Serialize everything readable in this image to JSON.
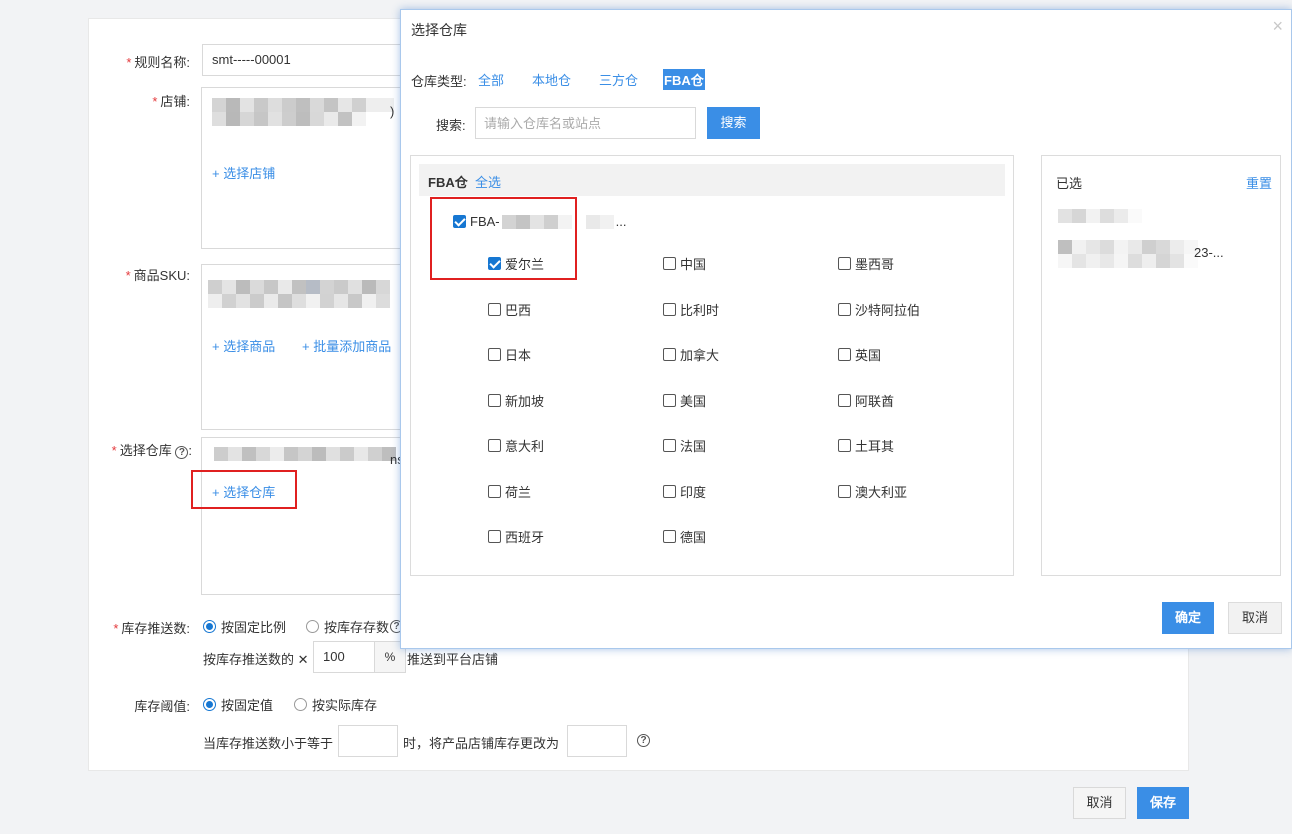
{
  "form": {
    "rule_name_label": "规则名称:",
    "rule_name_value": "smt-----00001",
    "shop_label": "店铺:",
    "shop_text_tail": ")",
    "select_shop": "+ 选择店铺",
    "sku_label": "商品SKU:",
    "select_product": "+ 选择商品",
    "batch_add_product": "+ 批量添加商品",
    "warehouse_label": "选择仓库",
    "warehouse_text_tail": "ns",
    "select_warehouse": "+ 选择仓库",
    "push_label": "库存推送数:",
    "push_option_ratio": "按固定比例",
    "push_option_stock": "按库存存数",
    "push_text_prefix": "按库存推送数的 ✕",
    "push_percent_value": "100",
    "push_percent_unit": "%",
    "push_text_suffix": "推送到平台店铺",
    "threshold_label": "库存阈值:",
    "threshold_option_fixed": "按固定值",
    "threshold_option_actual": "按实际库存",
    "threshold_text_prefix": "当库存推送数小于等于",
    "threshold_text_middle": "时，将产品店铺库存更改为",
    "threshold_min_value": "",
    "threshold_set_value": "",
    "cancel": "取消",
    "save": "保存"
  },
  "modal": {
    "title": "选择仓库",
    "close_glyph": "×",
    "type_label": "仓库类型:",
    "types": [
      {
        "label": "全部",
        "active": false
      },
      {
        "label": "本地仓",
        "active": false
      },
      {
        "label": "三方仓",
        "active": false
      },
      {
        "label": "FBA仓",
        "active": true
      }
    ],
    "search_label": "搜索:",
    "search_placeholder": "请输入仓库名或站点",
    "search_button": "搜索",
    "group_title": "FBA仓",
    "select_all": "全选",
    "parent_item": {
      "label_prefix": "FBA-",
      "label_suffix": "...",
      "checked": true
    },
    "countries": [
      {
        "label": "爱尔兰",
        "checked": true
      },
      {
        "label": "中国",
        "checked": false
      },
      {
        "label": "墨西哥",
        "checked": false
      },
      {
        "label": "巴西",
        "checked": false
      },
      {
        "label": "比利时",
        "checked": false
      },
      {
        "label": "沙特阿拉伯",
        "checked": false
      },
      {
        "label": "日本",
        "checked": false
      },
      {
        "label": "加拿大",
        "checked": false
      },
      {
        "label": "英国",
        "checked": false
      },
      {
        "label": "新加坡",
        "checked": false
      },
      {
        "label": "美国",
        "checked": false
      },
      {
        "label": "阿联酋",
        "checked": false
      },
      {
        "label": "意大利",
        "checked": false
      },
      {
        "label": "法国",
        "checked": false
      },
      {
        "label": "土耳其",
        "checked": false
      },
      {
        "label": "荷兰",
        "checked": false
      },
      {
        "label": "印度",
        "checked": false
      },
      {
        "label": "澳大利亚",
        "checked": false
      },
      {
        "label": "西班牙",
        "checked": false
      },
      {
        "label": "德国",
        "checked": false
      }
    ],
    "selected_title": "已选",
    "reset": "重置",
    "selected_item_tail": "23-...",
    "confirm": "确定",
    "cancel": "取消"
  },
  "colors": {
    "accent": "#3a8ee6",
    "required": "#e4393c",
    "highlight_box": "#e02020"
  }
}
